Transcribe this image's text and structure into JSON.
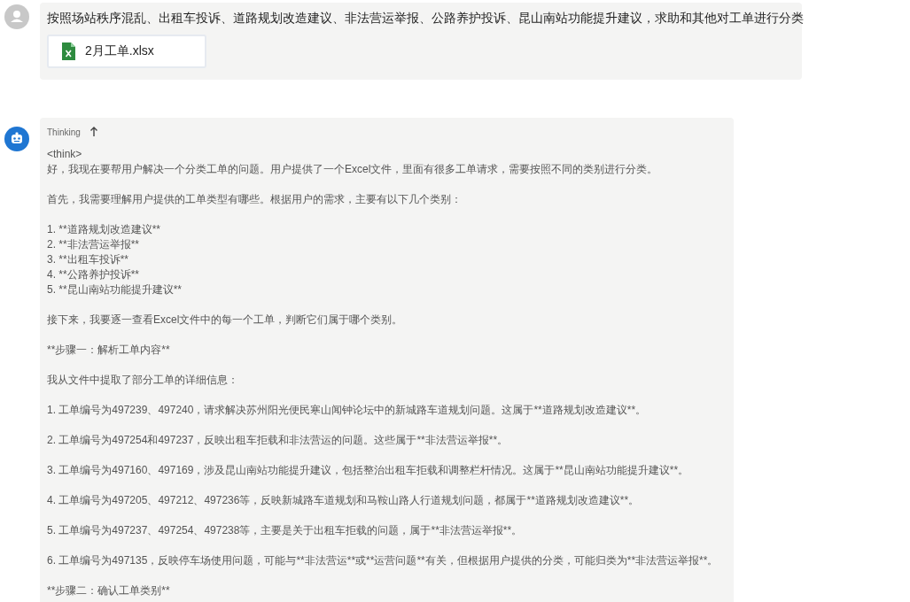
{
  "messages": [
    {
      "kind": "user",
      "text": "按照场站秩序混乱、出租车投诉、道路规划改造建议、非法营运举报、公路养护投诉、昆山南站功能提升建议，求助和其他对工单进行分类",
      "attachment": {
        "name": "2月工单.xlsx"
      }
    },
    {
      "kind": "assistant",
      "thinking": {
        "label": "Thinking",
        "expanded": true,
        "paragraphs": [
          [
            "<think>",
            "好，我现在要帮用户解决一个分类工单的问题。用户提供了一个Excel文件，里面有很多工单请求，需要按照不同的类别进行分类。"
          ],
          [
            "首先，我需要理解用户提供的工单类型有哪些。根据用户的需求，主要有以下几个类别："
          ],
          [
            "1. **道路规划改造建议**",
            "2. **非法营运举报**",
            "3. **出租车投诉**",
            "4. **公路养护投诉**",
            "5. **昆山南站功能提升建议**"
          ],
          [
            "接下来，我要逐一查看Excel文件中的每一个工单，判断它们属于哪个类别。"
          ],
          [
            "**步骤一：解析工单内容**"
          ],
          [
            "我从文件中提取了部分工单的详细信息："
          ],
          [
            "1. 工单编号为497239、497240，请求解决苏州阳光便民寒山闻钟论坛中的新城路车道规划问题。这属于**道路规划改造建议**。"
          ],
          [
            "2. 工单编号为497254和497237，反映出租车拒载和非法营运的问题。这些属于**非法营运举报**。"
          ],
          [
            "3. 工单编号为497160、497169，涉及昆山南站功能提升建议，包括整治出租车拒载和调整栏杆情况。这属于**昆山南站功能提升建议**。"
          ],
          [
            "4. 工单编号为497205、497212、497236等，反映新城路车道规划和马鞍山路人行道规划问题，都属于**道路规划改造建议**。"
          ],
          [
            "5. 工单编号为497237、497254、497238等，主要是关于出租车拒载的问题，属于**非法营运举报**。"
          ],
          [
            "6. 工单编号为497135，反映停车场使用问题，可能与**非法营运**或**运营问题**有关，但根据用户提供的分类，可能归类为**非法营运举报**。"
          ],
          [
            "**步骤二：确认工单类别**"
          ]
        ]
      }
    }
  ]
}
